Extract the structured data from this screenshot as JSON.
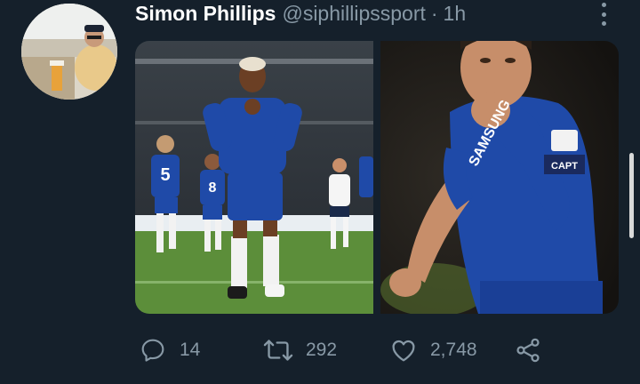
{
  "tweet": {
    "author": {
      "display_name": "Simon Phillips",
      "handle": "@siphillipssport",
      "separator": "·",
      "time": "1h"
    },
    "media": [
      {
        "kind": "photo",
        "shirt_numbers": [
          "5",
          "8"
        ]
      },
      {
        "kind": "photo",
        "shirt_text": "SAMSUNG",
        "armband": "CAPT"
      }
    ],
    "actions": {
      "replies": "14",
      "retweets": "292",
      "likes": "2,748"
    }
  },
  "colors": {
    "background": "#15202b",
    "muted_text": "#8899a6",
    "kit_blue": "#1f4aa8"
  },
  "icons": [
    "more-icon",
    "reply-icon",
    "retweet-icon",
    "like-icon",
    "share-icon"
  ]
}
